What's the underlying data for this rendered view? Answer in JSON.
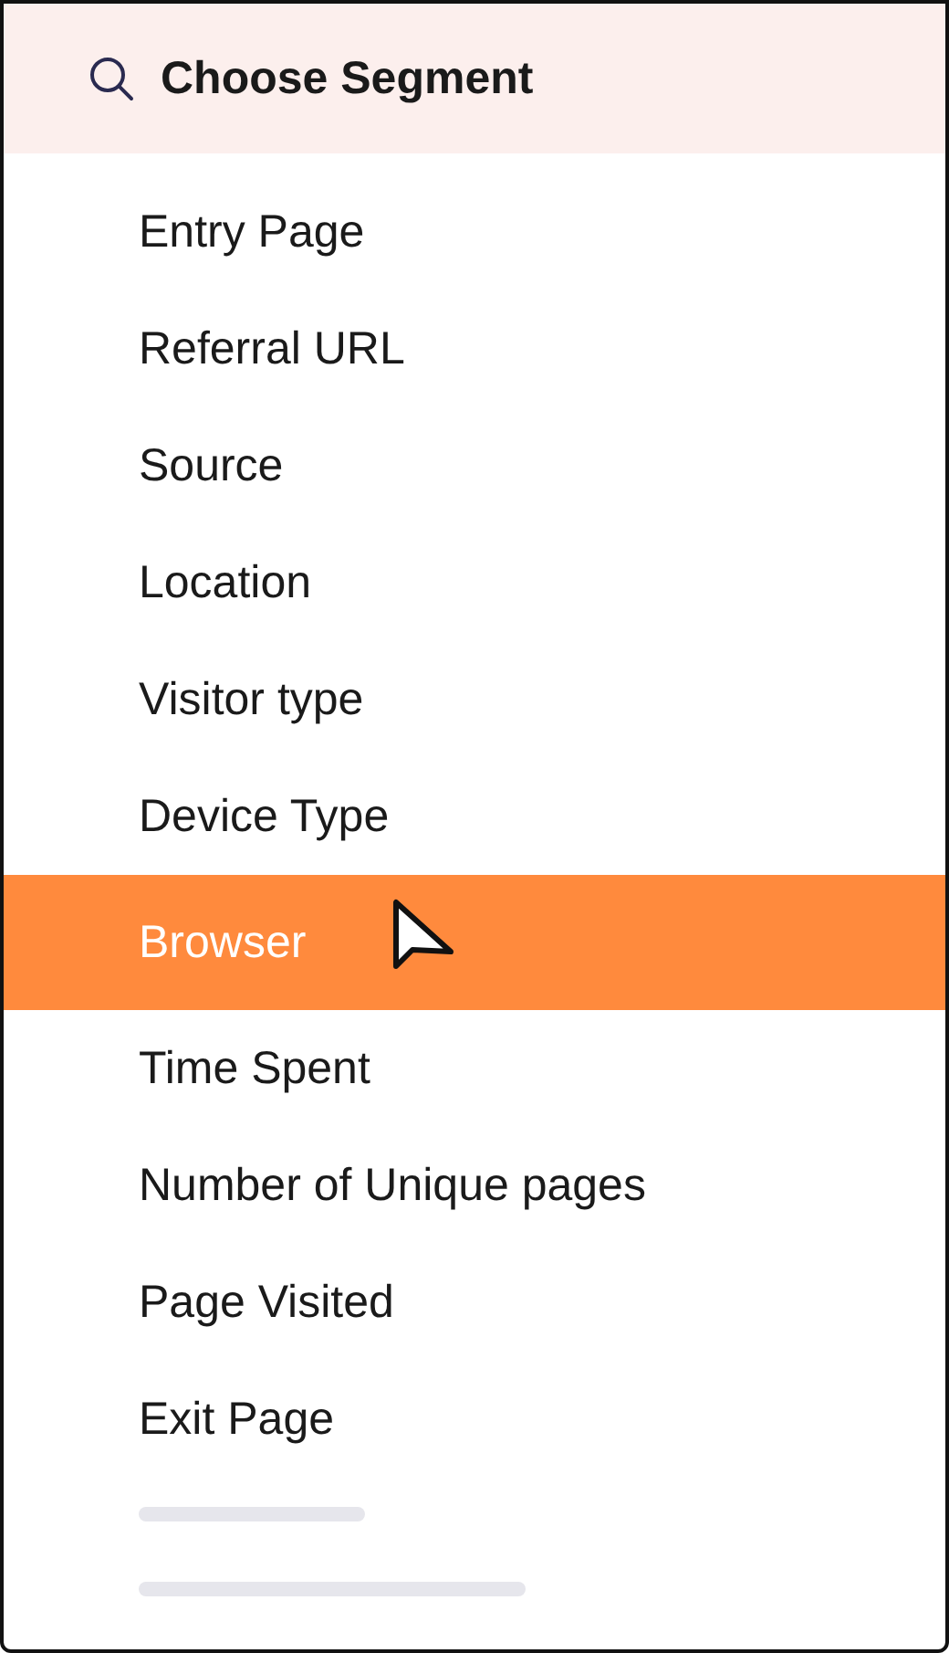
{
  "search": {
    "placeholder": "Choose Segment"
  },
  "items": [
    {
      "label": "Entry Page",
      "selected": false
    },
    {
      "label": "Referral URL",
      "selected": false
    },
    {
      "label": "Source",
      "selected": false
    },
    {
      "label": "Location",
      "selected": false
    },
    {
      "label": "Visitor type",
      "selected": false
    },
    {
      "label": "Device Type",
      "selected": false
    },
    {
      "label": "Browser",
      "selected": true
    },
    {
      "label": "Time Spent",
      "selected": false
    },
    {
      "label": "Number of Unique pages",
      "selected": false
    },
    {
      "label": "Page Visited",
      "selected": false
    },
    {
      "label": "Exit Page",
      "selected": false
    }
  ],
  "skeleton_rows": [
    {
      "kind": "short"
    },
    {
      "kind": "long"
    }
  ]
}
